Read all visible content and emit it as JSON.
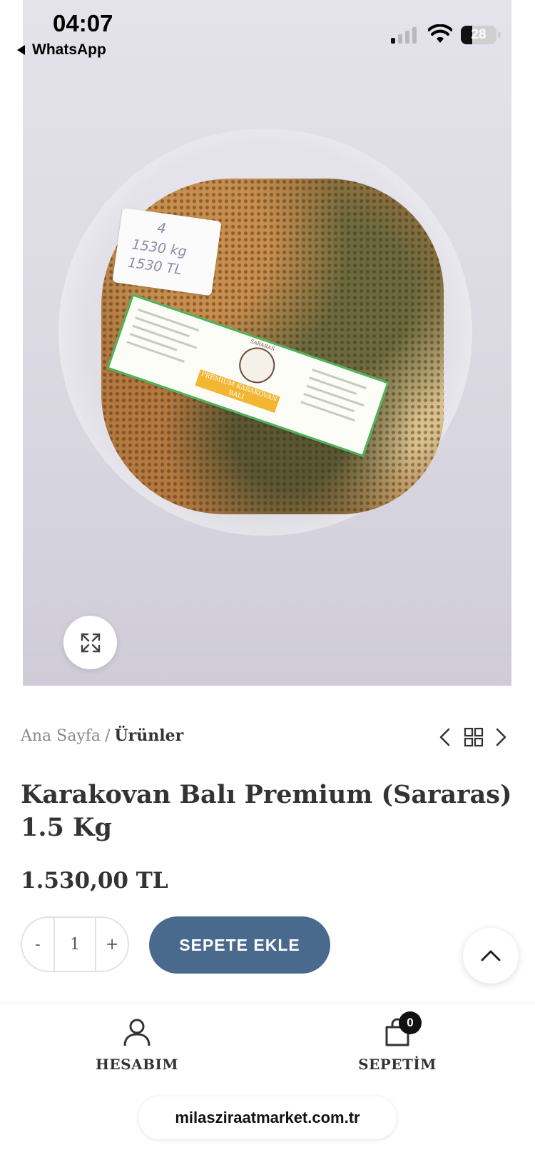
{
  "status_bar": {
    "time": "04:07",
    "back_app": "WhatsApp",
    "battery": "28"
  },
  "product_image": {
    "sticker_lines": [
      "4",
      "1530 kg",
      "1530 TL"
    ],
    "label_brand": "SARARAS",
    "label_band": "PREMIUM KARAKOVAN BALI",
    "expand_icon": "expand-icon"
  },
  "breadcrumb": {
    "home": "Ana Sayfa",
    "separator": "/",
    "current": "Ürünler"
  },
  "product": {
    "title": "Karakovan Balı Premium (Sararas) 1.5 Kg",
    "price": "1.530,00 TL"
  },
  "quantity": {
    "minus": "-",
    "value": "1",
    "plus": "+"
  },
  "add_to_cart": "SEPETE EKLE",
  "toolbar": {
    "account_label": "HESABIM",
    "cart_label": "SEPETİM",
    "cart_count": "0"
  },
  "url": "milasziraatmarket.com.tr",
  "colors": {
    "accent": "#4a6a8d",
    "text": "#333333",
    "muted": "#8a8a8a"
  }
}
